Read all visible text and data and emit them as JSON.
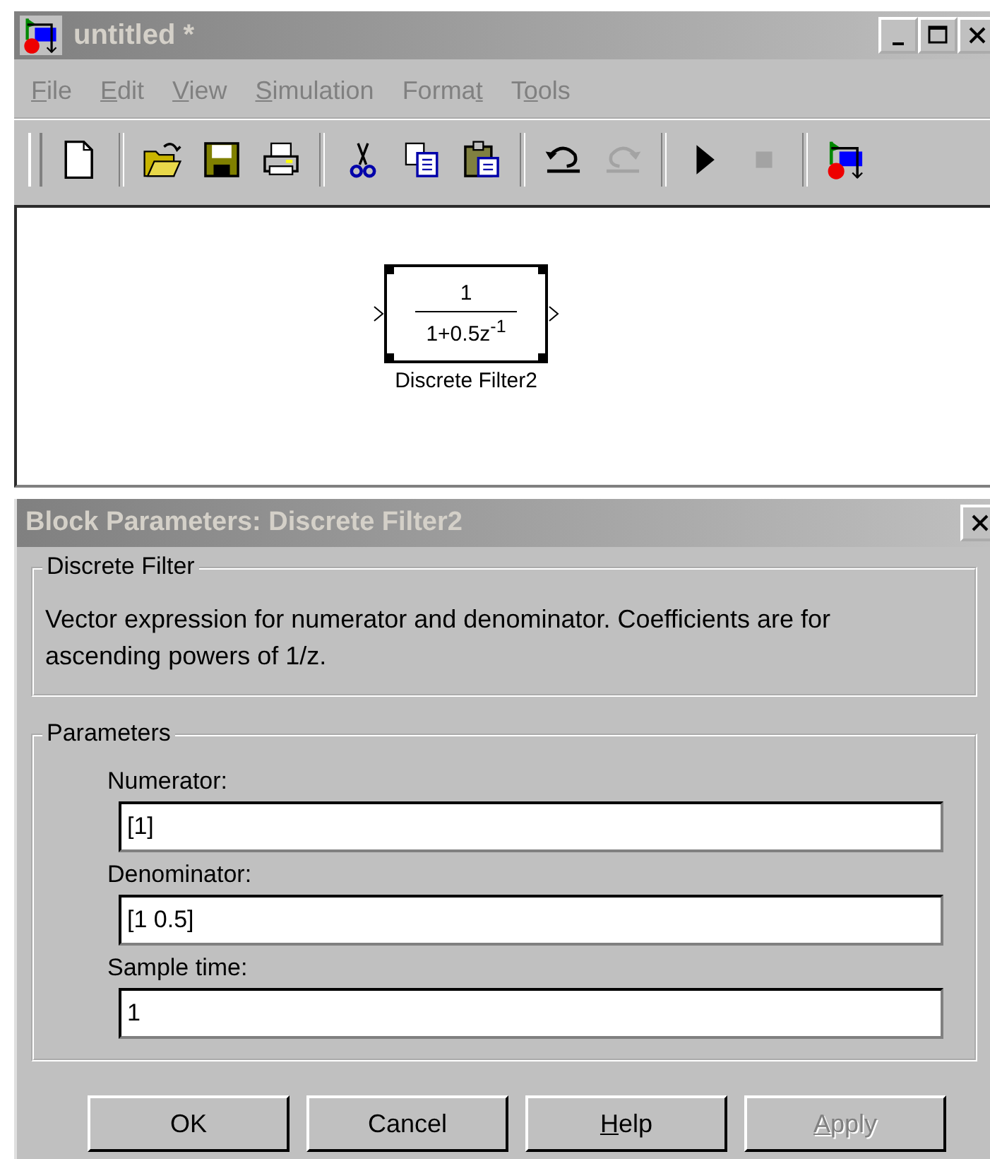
{
  "window": {
    "title": "untitled *",
    "controls": [
      {
        "kind": "minimize"
      },
      {
        "kind": "maximize"
      },
      {
        "kind": "close"
      }
    ]
  },
  "menu": [
    {
      "key": "F",
      "post": "ile"
    },
    {
      "key": "E",
      "post": "dit"
    },
    {
      "key": "V",
      "post": "iew"
    },
    {
      "key": "S",
      "post": "imulation"
    },
    {
      "pre": "Forma",
      "key": "t"
    },
    {
      "pre": "T",
      "key": "o",
      "post": "ols"
    }
  ],
  "toolbar": [
    {
      "kind": "new",
      "disabled": false
    },
    {
      "kind": "sep"
    },
    {
      "kind": "open",
      "disabled": false
    },
    {
      "kind": "save",
      "disabled": false
    },
    {
      "kind": "print",
      "disabled": false
    },
    {
      "kind": "sep"
    },
    {
      "kind": "cut",
      "disabled": false
    },
    {
      "kind": "copy",
      "disabled": false
    },
    {
      "kind": "paste",
      "disabled": false
    },
    {
      "kind": "sep"
    },
    {
      "kind": "undo",
      "disabled": false
    },
    {
      "kind": "redo",
      "disabled": true
    },
    {
      "kind": "sep"
    },
    {
      "kind": "start",
      "disabled": false
    },
    {
      "kind": "stop",
      "disabled": true
    },
    {
      "kind": "sep"
    },
    {
      "kind": "library",
      "disabled": false
    }
  ],
  "block": {
    "numerator": "1",
    "denominator": "1+0.5z$^{-1}$",
    "label": "Discrete Filter2",
    "selected": true
  },
  "dialog": {
    "title": "Block Parameters: Discrete Filter2",
    "description_group": {
      "legend": "Discrete Filter",
      "text": "Vector expression for numerator and denominator.  Coefficients are for ascending powers of 1/z."
    },
    "parameters_group": {
      "legend": "Parameters",
      "fields": [
        {
          "label": "Numerator:",
          "value": "[1]"
        },
        {
          "label": "Denominator:",
          "value": "[1 0.5]"
        },
        {
          "label": "Sample time:",
          "value": "1"
        }
      ]
    },
    "buttons": [
      {
        "pre": "OK",
        "disabled": false
      },
      {
        "pre": "Cancel",
        "disabled": false
      },
      {
        "key": "H",
        "post": "elp",
        "disabled": false
      },
      {
        "key": "A",
        "post": "pply",
        "disabled": true
      }
    ]
  }
}
